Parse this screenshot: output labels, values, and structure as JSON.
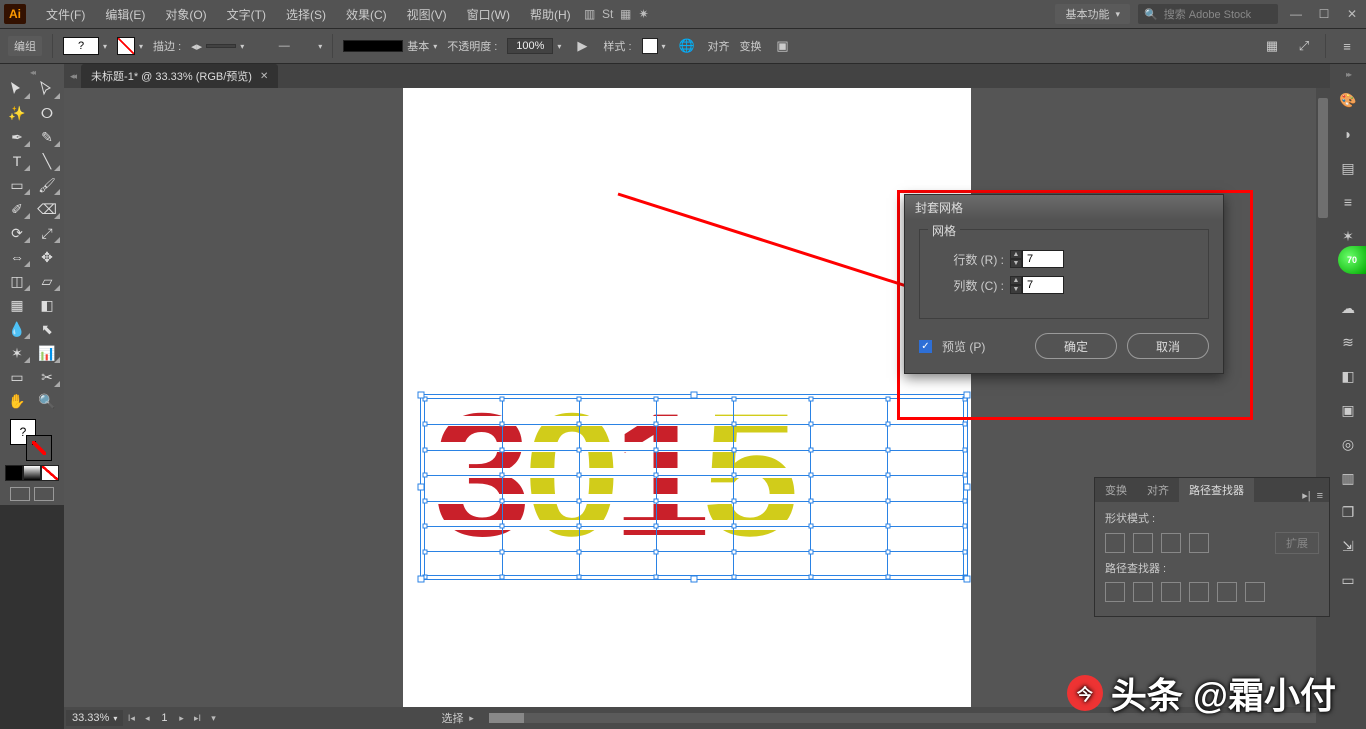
{
  "menu": {
    "items": [
      "文件(F)",
      "编辑(E)",
      "对象(O)",
      "文字(T)",
      "选择(S)",
      "效果(C)",
      "视图(V)",
      "窗口(W)",
      "帮助(H)"
    ],
    "workspace": "基本功能",
    "search_placeholder": "搜索 Adobe Stock"
  },
  "options": {
    "selection_label": "编组",
    "stroke_label": "描边 :",
    "stroke_dash": "—",
    "profile_label": "基本",
    "opacity_label": "不透明度 :",
    "opacity_value": "100%",
    "style_label": "样式 :",
    "menuA": "对齐",
    "menuB": "变换"
  },
  "document": {
    "tab_title": "未标题-1* @ 33.33% (RGB/预览)",
    "numbers": [
      "3",
      "0",
      "1",
      "5"
    ]
  },
  "dialog": {
    "title": "封套网格",
    "group": "网格",
    "rows_label": "行数 (R) :",
    "rows_value": "7",
    "cols_label": "列数 (C) :",
    "cols_value": "7",
    "preview_label": "预览 (P)",
    "ok": "确定",
    "cancel": "取消"
  },
  "status": {
    "zoom": "33.33%",
    "page": "1",
    "mode": "选择"
  },
  "panel": {
    "tabs": [
      "变换",
      "对齐",
      "路径查找器"
    ],
    "shape_mode": "形状模式 :",
    "expand": "扩展",
    "pathfinders": "路径查找器 :"
  },
  "toolbox": {
    "fill_mark": "?"
  },
  "badge": {
    "text": "70"
  },
  "watermark": {
    "text": "头条 @霜小付"
  },
  "chart_data": {
    "type": "table",
    "title": "封套网格",
    "rows": 7,
    "cols": 7,
    "canvas_text": "3015",
    "zoom_percent": 33.33
  }
}
